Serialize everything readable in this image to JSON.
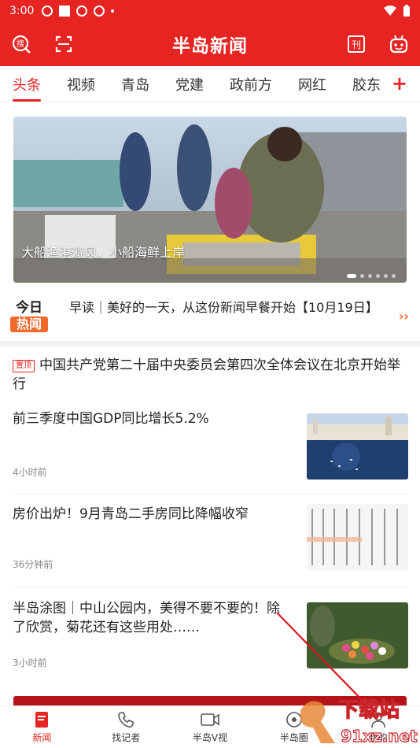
{
  "status": {
    "time": "3:00"
  },
  "header": {
    "logo": "半岛新闻"
  },
  "tabs": [
    "头条",
    "视频",
    "青岛",
    "党建",
    "政前方",
    "网红",
    "胶东"
  ],
  "tab_plus": "+",
  "banner": {
    "caption": "大船渔港避风，小船海鲜上岸"
  },
  "today": {
    "top": "今日",
    "bottom": "热闻",
    "text": "早读｜美好的一天，从这份新闻早餐开始【10月19日】",
    "arrow": "››"
  },
  "pinned": {
    "tag": "置顶",
    "title": "中国共产党第二十届中央委员会第四次全体会议在北京开始举行"
  },
  "news": [
    {
      "title": "前三季度中国GDP同比增长5.2%",
      "time": "4小时前"
    },
    {
      "title": "房价出炉！9月青岛二手房同比降幅收窄",
      "time": "36分钟前"
    },
    {
      "title": "半岛涂图｜中山公园内，美得不要不要的！除了欣赏，菊花还有这些用处……",
      "time": "3小时前"
    }
  ],
  "bottom_nav": [
    {
      "label": "新闻",
      "icon": "news-icon"
    },
    {
      "label": "找记者",
      "icon": "phone-icon"
    },
    {
      "label": "半岛V视",
      "icon": "video-icon"
    },
    {
      "label": "半岛圈",
      "icon": "circle-icon"
    },
    {
      "label": "我的",
      "icon": "user-icon"
    }
  ],
  "watermark": {
    "text1": "下载站",
    "text2": "91xz.net"
  },
  "colors": {
    "brand": "#e62421",
    "accent": "#f26a2b"
  }
}
